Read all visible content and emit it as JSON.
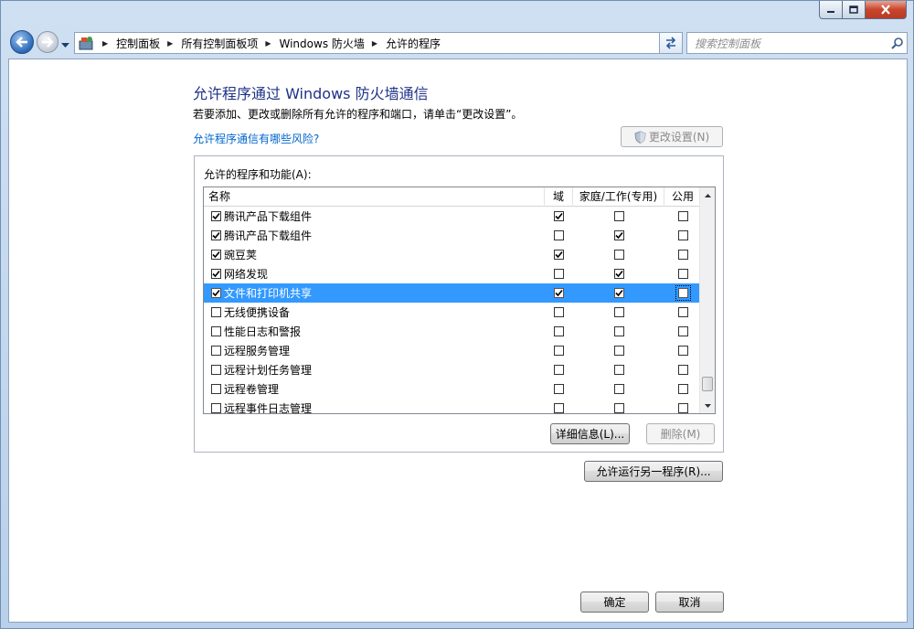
{
  "window": {
    "controls": [
      "minimize",
      "maximize",
      "close"
    ]
  },
  "nav": {
    "breadcrumbs": [
      "控制面板",
      "所有控制面板项",
      "Windows 防火墙",
      "允许的程序"
    ],
    "search_placeholder": "搜索控制面板"
  },
  "main": {
    "heading": "允许程序通过 Windows 防火墙通信",
    "subtext": "若要添加、更改或删除所有允许的程序和端口，请单击“更改设置”。",
    "risk_link": "允许程序通信有哪些风险?",
    "change_settings_label": "更改设置(N)",
    "group_label": "允许的程序和功能(A):",
    "columns": {
      "name": "名称",
      "domain": "域",
      "home": "家庭/工作(专用)",
      "public": "公用"
    },
    "rows": [
      {
        "name": "腾讯产品下载组件",
        "enabled": true,
        "domain": true,
        "home": false,
        "public": false,
        "selected": false
      },
      {
        "name": "腾讯产品下载组件",
        "enabled": true,
        "domain": false,
        "home": true,
        "public": false,
        "selected": false
      },
      {
        "name": "豌豆荚",
        "enabled": true,
        "domain": true,
        "home": false,
        "public": false,
        "selected": false
      },
      {
        "name": "网络发现",
        "enabled": true,
        "domain": false,
        "home": true,
        "public": false,
        "selected": false
      },
      {
        "name": "文件和打印机共享",
        "enabled": true,
        "domain": true,
        "home": true,
        "public": false,
        "selected": true
      },
      {
        "name": "无线便携设备",
        "enabled": false,
        "domain": false,
        "home": false,
        "public": false,
        "selected": false
      },
      {
        "name": "性能日志和警报",
        "enabled": false,
        "domain": false,
        "home": false,
        "public": false,
        "selected": false
      },
      {
        "name": "远程服务管理",
        "enabled": false,
        "domain": false,
        "home": false,
        "public": false,
        "selected": false
      },
      {
        "name": "远程计划任务管理",
        "enabled": false,
        "domain": false,
        "home": false,
        "public": false,
        "selected": false
      },
      {
        "name": "远程卷管理",
        "enabled": false,
        "domain": false,
        "home": false,
        "public": false,
        "selected": false
      },
      {
        "name": "远程事件日志管理",
        "enabled": false,
        "domain": false,
        "home": false,
        "public": false,
        "selected": false
      }
    ],
    "details_label": "详细信息(L)...",
    "remove_label": "删除(M)",
    "allow_other_label": "允许运行另一程序(R)..."
  },
  "footer": {
    "ok_label": "确定",
    "cancel_label": "取消"
  }
}
